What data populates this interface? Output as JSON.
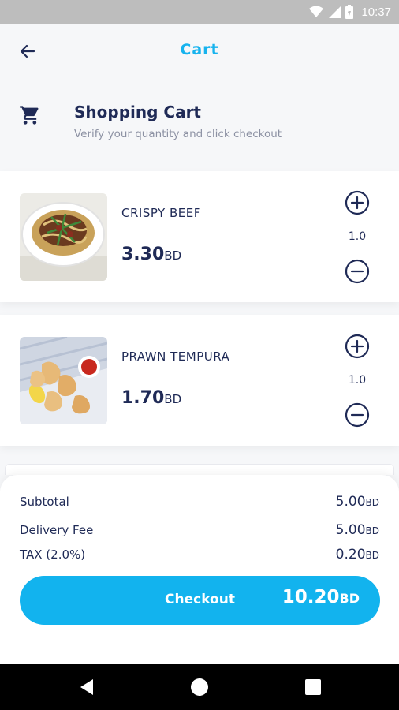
{
  "status_bar": {
    "time": "10:37",
    "icons": [
      "wifi-icon",
      "signal-icon",
      "battery-icon"
    ]
  },
  "app_bar": {
    "title": "Cart",
    "back_icon": "arrow-left-icon"
  },
  "header": {
    "icon": "shopping-cart-icon",
    "title": "Shopping Cart",
    "subtitle": "Verify your quantity and click checkout"
  },
  "items": [
    {
      "name": "CRISPY BEEF",
      "price": "3.30",
      "currency": "BD",
      "quantity": "1.0",
      "image": "crispy-beef-noodles"
    },
    {
      "name": "PRAWN TEMPURA",
      "price": "1.70",
      "currency": "BD",
      "quantity": "1.0",
      "image": "prawn-tempura-platter"
    }
  ],
  "summary": {
    "subtotal_label": "Subtotal",
    "subtotal_value": "5.00",
    "subtotal_currency": "BD",
    "delivery_label": "Delivery Fee",
    "delivery_value": "5.00",
    "delivery_currency": "BD",
    "tax_label": "TAX (2.0%)",
    "tax_value": "0.20",
    "tax_currency": "BD"
  },
  "checkout": {
    "label": "Checkout",
    "total": "10.20",
    "currency": "BD"
  },
  "colors": {
    "accent": "#12b3ee",
    "title_accent": "#17b3ee",
    "text": "#1f2a56",
    "muted": "#8c91a3",
    "status_bar": "#bdbdbd"
  },
  "nav_bar": {
    "icons": [
      "nav-back-icon",
      "nav-home-icon",
      "nav-recents-icon"
    ]
  }
}
